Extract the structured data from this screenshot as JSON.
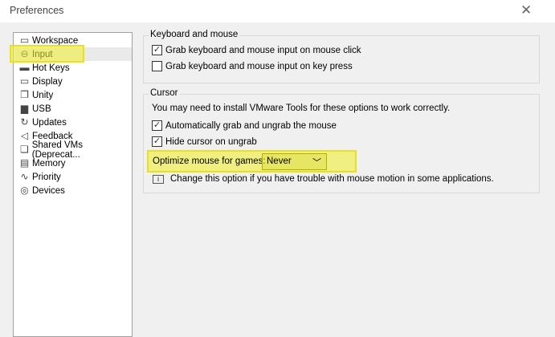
{
  "window": {
    "title": "Preferences"
  },
  "sidebar": {
    "items": [
      {
        "label": "Workspace",
        "icon": "workspace-icon",
        "glyph": "▭"
      },
      {
        "label": "Input",
        "icon": "mouse-icon",
        "glyph": "⊖"
      },
      {
        "label": "Hot Keys",
        "icon": "keyboard-icon",
        "glyph": "▬"
      },
      {
        "label": "Display",
        "icon": "display-icon",
        "glyph": "▭"
      },
      {
        "label": "Unity",
        "icon": "unity-icon",
        "glyph": "❐"
      },
      {
        "label": "USB",
        "icon": "usb-icon",
        "glyph": "▆"
      },
      {
        "label": "Updates",
        "icon": "updates-icon",
        "glyph": "↻"
      },
      {
        "label": "Feedback",
        "icon": "feedback-icon",
        "glyph": "◁"
      },
      {
        "label": "Shared VMs (Deprecat...",
        "icon": "shared-vms-icon",
        "glyph": "❏"
      },
      {
        "label": "Memory",
        "icon": "memory-icon",
        "glyph": "▤"
      },
      {
        "label": "Priority",
        "icon": "priority-icon",
        "glyph": "∿"
      },
      {
        "label": "Devices",
        "icon": "devices-icon",
        "glyph": "◎"
      }
    ],
    "selected": "Input"
  },
  "keyboard": {
    "title": "Keyboard and mouse",
    "options": [
      {
        "label": "Grab keyboard and mouse input on mouse click",
        "checked": true
      },
      {
        "label": "Grab keyboard and mouse input on key press",
        "checked": false
      }
    ]
  },
  "cursor": {
    "title": "Cursor",
    "note": "You may need to install VMware Tools for these options to work correctly.",
    "options": [
      {
        "label": "Automatically grab and ungrab the mouse",
        "checked": true
      },
      {
        "label": "Hide cursor on ungrab",
        "checked": true
      }
    ],
    "optimize_label": "Optimize mouse for games:",
    "optimize_value": "Never",
    "info": "Change this option if you have trouble with mouse motion in some applications."
  }
}
